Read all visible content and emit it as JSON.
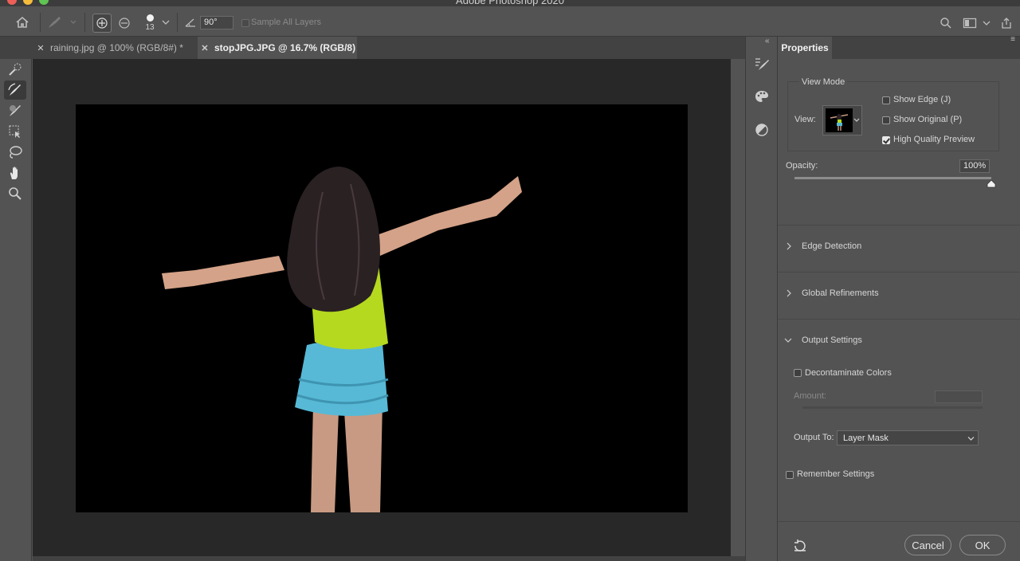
{
  "window": {
    "title": "Adobe Photoshop 2020"
  },
  "options_bar": {
    "brush_size": "13",
    "angle_value": "90°",
    "sample_all_layers_label": "Sample All Layers",
    "sample_all_layers_checked": false
  },
  "tabs": [
    {
      "label": "raining.jpg @ 100% (RGB/8#) *",
      "active": false
    },
    {
      "label": "stopJPG.JPG @ 16.7% (RGB/8)",
      "active": true
    }
  ],
  "properties": {
    "panel_title": "Properties",
    "view_mode": {
      "section_label": "View Mode",
      "view_label": "View:",
      "show_edge_label": "Show Edge (J)",
      "show_edge_checked": false,
      "show_original_label": "Show Original (P)",
      "show_original_checked": false,
      "high_quality_label": "High Quality Preview",
      "high_quality_checked": true
    },
    "opacity": {
      "label": "Opacity:",
      "value": "100%",
      "level": 1.0
    },
    "edge_detection_label": "Edge Detection",
    "global_refinements_label": "Global Refinements",
    "output_settings": {
      "label": "Output Settings",
      "decontaminate_label": "Decontaminate Colors",
      "decontaminate_checked": false,
      "amount_label": "Amount:",
      "output_to_label": "Output To:",
      "output_to_value": "Layer Mask"
    },
    "remember_label": "Remember Settings",
    "remember_checked": false,
    "cancel_label": "Cancel",
    "ok_label": "OK"
  },
  "colors": {
    "accent": "#ffffff",
    "canvas_bg": "#000000",
    "panel_bg": "#535353"
  }
}
